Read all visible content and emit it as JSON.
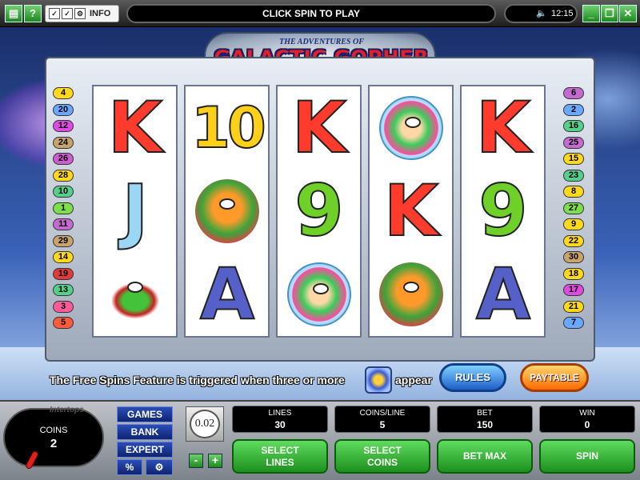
{
  "topbar": {
    "menu_icon": "menu-icon",
    "help_label": "?",
    "info_label": "INFO",
    "message": "CLICK SPIN TO PLAY",
    "time": "12:15",
    "window_icons": [
      "minimize-icon",
      "restore-icon",
      "close-icon"
    ]
  },
  "title": {
    "small": "THE ADVENTURES OF",
    "big": "GALACTIC GOPHER"
  },
  "reels": [
    [
      "K",
      "J",
      "SNAKE"
    ],
    [
      "10",
      "GOPHER",
      "A"
    ],
    [
      "K",
      "9",
      "GIRL"
    ],
    [
      "GIRL",
      "K",
      "GOPHER"
    ],
    [
      "K",
      "9",
      "A"
    ]
  ],
  "paylines": {
    "left": [
      "4",
      "20",
      "12",
      "24",
      "26",
      "28",
      "10",
      "1",
      "11",
      "29",
      "14",
      "19",
      "13",
      "3",
      "5"
    ],
    "right": [
      "6",
      "2",
      "16",
      "25",
      "15",
      "23",
      "8",
      "27",
      "9",
      "22",
      "30",
      "18",
      "17",
      "21",
      "7"
    ]
  },
  "info": {
    "free_spins_text": "The Free Spins Feature is triggered when three or more",
    "free_spins_text2": "appear",
    "rules": "RULES",
    "paytable": "PAYTABLE"
  },
  "panel": {
    "brand": "Intertops",
    "coins_label": "COINS",
    "coins_value": "2",
    "menu": {
      "games": "GAMES",
      "bank": "BANK",
      "expert": "EXPERT",
      "percent": "%",
      "settings_icon": "gear-icon"
    },
    "denomination": "0.02",
    "minus": "-",
    "plus": "+",
    "readouts": [
      {
        "label": "LINES",
        "value": "30"
      },
      {
        "label": "COINS/LINE",
        "value": "5"
      },
      {
        "label": "BET",
        "value": "150"
      },
      {
        "label": "WIN",
        "value": "0"
      }
    ],
    "buttons": {
      "select_lines": "SELECT\nLINES",
      "select_coins": "SELECT\nCOINS",
      "bet_max": "BET MAX",
      "spin": "SPIN"
    }
  },
  "colors": {
    "payline_colors": [
      "#ffd91a",
      "#6aa8ff",
      "#e04ae0",
      "#c8a36a",
      "#d05ad0",
      "#ffd91a",
      "#54d08c",
      "#7be04a",
      "#c46ad0",
      "#c8a36a",
      "#ffd91a",
      "#e03a3a",
      "#54d08c",
      "#ff5a9a",
      "#ff5a3a"
    ],
    "spin_green": "#1d8f1d",
    "menu_blue": "#0e2470"
  }
}
